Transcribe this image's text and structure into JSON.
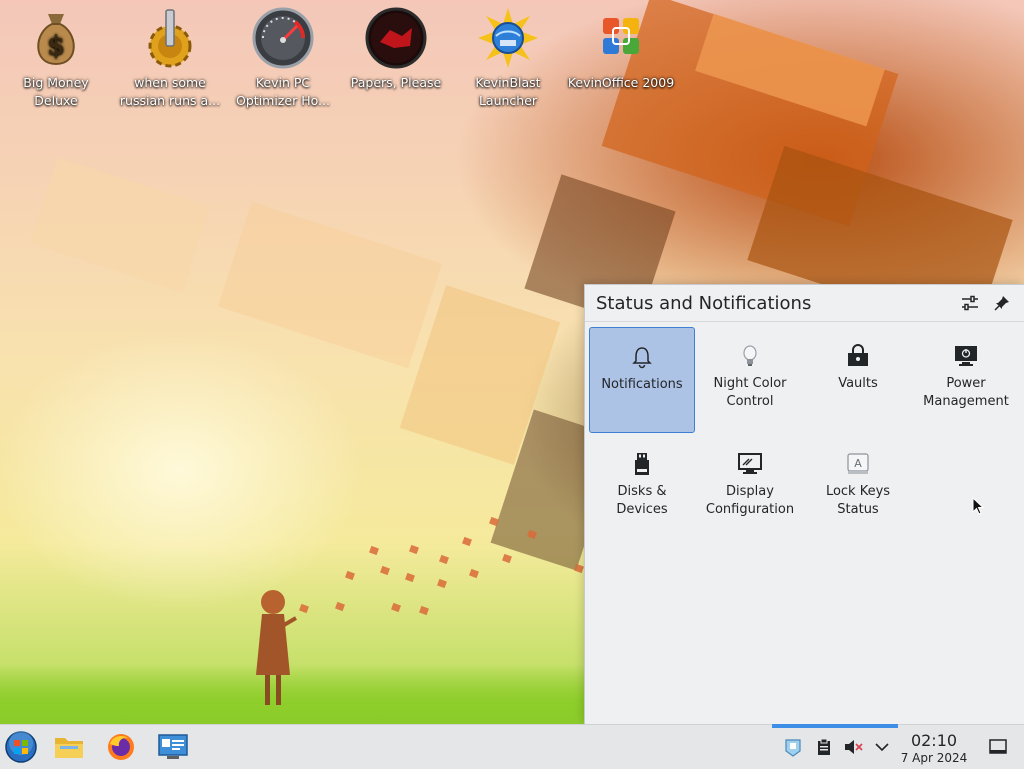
{
  "desktop": {
    "icons": [
      {
        "id": "big-money",
        "label": "Big Money Deluxe",
        "icon": "money-bag-icon"
      },
      {
        "id": "russian",
        "label": "when some russian runs a...",
        "icon": "gear-icon"
      },
      {
        "id": "kevin-pc",
        "label": "Kevin PC Optimizer Ho...",
        "icon": "speedometer-icon"
      },
      {
        "id": "papers",
        "label": "Papers, Please",
        "icon": "red-seal-icon"
      },
      {
        "id": "kevinblast",
        "label": "KevinBlast Launcher",
        "icon": "globe-burst-icon"
      },
      {
        "id": "kevinoffice",
        "label": "KevinOffice 2009",
        "icon": "office-logo-icon"
      }
    ]
  },
  "popup": {
    "title": "Status and Notifications",
    "items": [
      {
        "id": "notifications",
        "label": "Notifications",
        "icon": "bell-icon",
        "selected": true
      },
      {
        "id": "night-color",
        "label": "Night Color Control",
        "icon": "lightbulb-icon"
      },
      {
        "id": "vaults",
        "label": "Vaults",
        "icon": "vault-lock-icon"
      },
      {
        "id": "power",
        "label": "Power Management",
        "icon": "monitor-power-icon"
      },
      {
        "id": "disks",
        "label": "Disks & Devices",
        "icon": "usb-drive-icon"
      },
      {
        "id": "display",
        "label": "Display Configuration",
        "icon": "display-icon"
      },
      {
        "id": "lockkeys",
        "label": "Lock Keys Status",
        "icon": "keyboard-key-icon"
      }
    ]
  },
  "taskbar": {
    "clock_time": "02:10",
    "clock_date": "7 Apr 2024"
  },
  "colors": {
    "accent": "#3d8ee6",
    "selection_bg": "#adc3e6",
    "panel_bg": "#eff0f1",
    "taskbar_bg": "#e4e6e8"
  }
}
